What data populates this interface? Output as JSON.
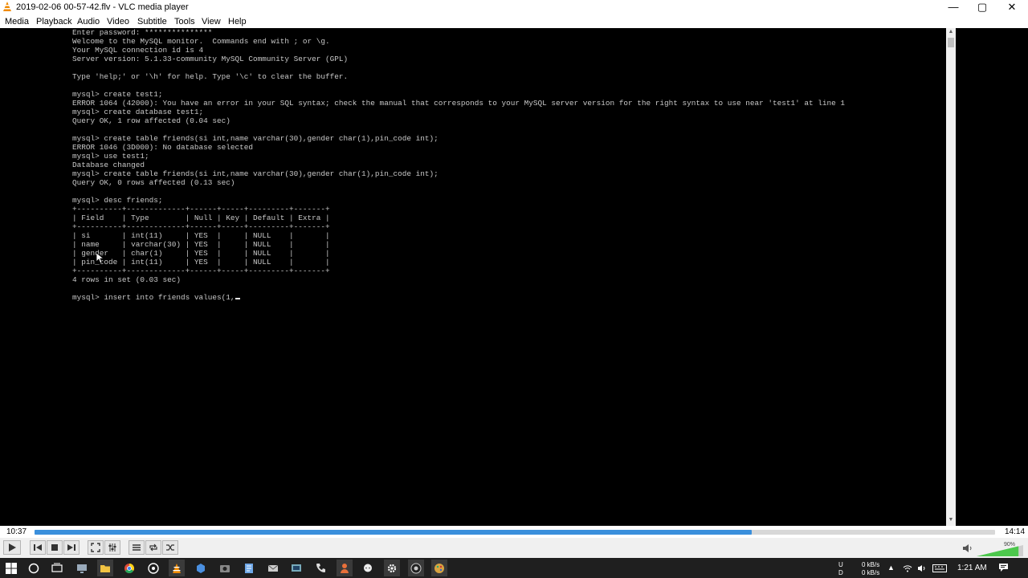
{
  "window": {
    "title": "2019-02-06 00-57-42.flv - VLC media player"
  },
  "menu": [
    "Media",
    "Playback",
    "Audio",
    "Video",
    "Subtitle",
    "Tools",
    "View",
    "Help"
  ],
  "console": {
    "lines": [
      "Enter password: ***************",
      "Welcome to the MySQL monitor.  Commands end with ; or \\g.",
      "Your MySQL connection id is 4",
      "Server version: 5.1.33-community MySQL Community Server (GPL)",
      "",
      "Type 'help;' or '\\h' for help. Type '\\c' to clear the buffer.",
      "",
      "mysql> create test1;",
      "ERROR 1064 (42000): You have an error in your SQL syntax; check the manual that corresponds to your MySQL server version for the right syntax to use near 'test1' at line 1",
      "mysql> create database test1;",
      "Query OK, 1 row affected (0.04 sec)",
      "",
      "mysql> create table friends(si int,name varchar(30),gender char(1),pin_code int);",
      "ERROR 1046 (3D000): No database selected",
      "mysql> use test1;",
      "Database changed",
      "mysql> create table friends(si int,name varchar(30),gender char(1),pin_code int);",
      "Query OK, 0 rows affected (0.13 sec)",
      "",
      "mysql> desc friends;",
      "+----------+-------------+------+-----+---------+-------+",
      "| Field    | Type        | Null | Key | Default | Extra |",
      "+----------+-------------+------+-----+---------+-------+",
      "| si       | int(11)     | YES  |     | NULL    |       |",
      "| name     | varchar(30) | YES  |     | NULL    |       |",
      "| gender   | char(1)     | YES  |     | NULL    |       |",
      "| pin_code | int(11)     | YES  |     | NULL    |       |",
      "+----------+-------------+------+-----+---------+-------+",
      "4 rows in set (0.03 sec)",
      "",
      "mysql> insert into friends values(1,"
    ]
  },
  "player": {
    "elapsed": "10:37",
    "total": "14:14",
    "progress": 0.747,
    "volume_label": "90%",
    "volume": 0.9
  },
  "controls": [
    {
      "name": "play-button",
      "icon": "play-icon"
    },
    {
      "name": "previous-button",
      "icon": "skip-back-icon"
    },
    {
      "name": "stop-button",
      "icon": "stop-icon"
    },
    {
      "name": "next-button",
      "icon": "skip-forward-icon"
    },
    {
      "name": "fullscreen-button",
      "icon": "fullscreen-icon"
    },
    {
      "name": "extended-settings-button",
      "icon": "sliders-icon"
    },
    {
      "name": "playlist-button",
      "icon": "playlist-icon"
    },
    {
      "name": "loop-button",
      "icon": "loop-icon"
    },
    {
      "name": "shuffle-button",
      "icon": "shuffle-icon"
    }
  ],
  "tray": {
    "net_up": "0 kB/s",
    "net_down": "0 kB/s",
    "u_label": "U",
    "d_label": "D",
    "clock": "1:21 AM"
  },
  "colors": {
    "accent": "#3a8fdc",
    "volume": "#4cc84c"
  }
}
